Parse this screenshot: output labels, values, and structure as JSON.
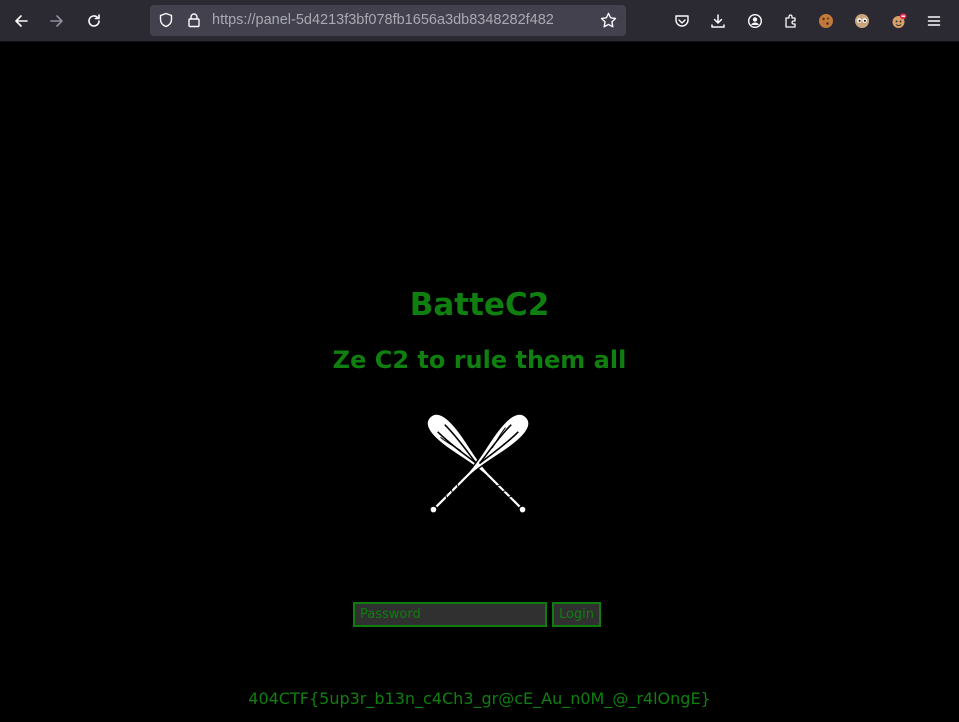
{
  "browser": {
    "url": "https://panel-5d4213f3bf078fb1656a3db8348282f482",
    "toolbar_icons": [
      "back-icon",
      "forward-icon",
      "reload-icon",
      "shield-icon",
      "lock-icon",
      "bookmark-star-icon",
      "pocket-icon",
      "download-icon",
      "account-icon",
      "extensions-icon",
      "cookie-extension-icon",
      "eyes-extension-icon",
      "extension-with-badge-icon",
      "menu-icon"
    ],
    "colors": {
      "toolbar_bg": "#2b2a33",
      "urlbar_bg": "#42414d",
      "icon": "#fbfbfe"
    }
  },
  "page": {
    "title": "BatteC2",
    "subtitle": "Ze C2 to rule them all",
    "logo": "crossed-baseball-bats-icon",
    "password_placeholder": "Password",
    "login_label": "Login",
    "flag": "404CTF{5up3r_b13n_c4Ch3_gr@cE_Au_n0M_@_r4lOngE}",
    "colors": {
      "background": "#000000",
      "accent": "#0f7f0f",
      "input_bg": "#303030"
    }
  }
}
